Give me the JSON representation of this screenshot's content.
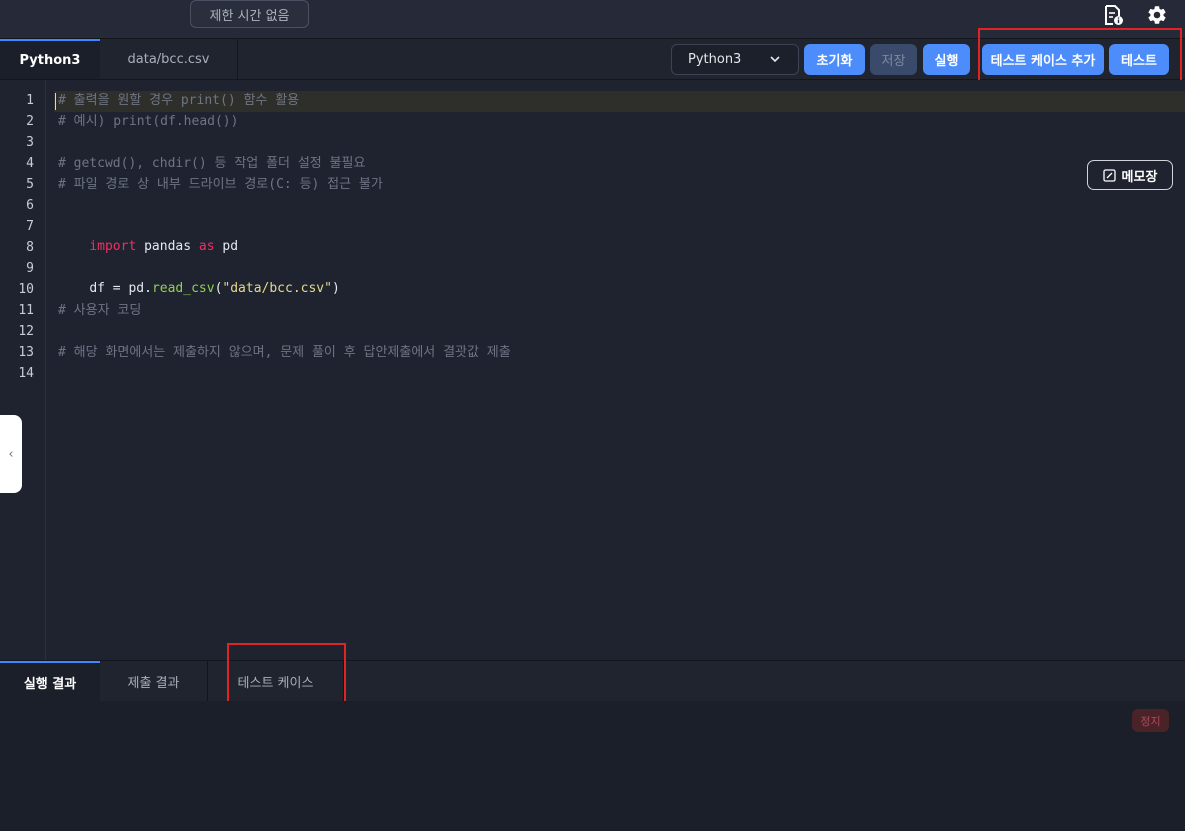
{
  "header": {
    "timer_label": "제한 시간 없음",
    "icons": [
      "file-info-icon",
      "gear-icon"
    ]
  },
  "tabs": [
    {
      "label": "Python3",
      "active": true
    },
    {
      "label": "data/bcc.csv",
      "active": false
    }
  ],
  "toolbar": {
    "language_selected": "Python3",
    "reset_label": "초기화",
    "save_label": "저장",
    "run_label": "실행",
    "add_testcase_label": "테스트 케이스 추가",
    "test_label": "테스트"
  },
  "editor": {
    "line_numbers": [
      "1",
      "2",
      "3",
      "4",
      "5",
      "6",
      "7",
      "8",
      "9",
      "10",
      "11",
      "12",
      "13",
      "14"
    ],
    "lines": {
      "l1": "# 출력을 원할 경우 print() 함수 활용",
      "l2": "# 예시) print(df.head())",
      "l4": "# getcwd(), chdir() 등 작업 폴더 설정 불필요",
      "l5": "# 파일 경로 상 내부 드라이브 경로(C: 등) 접근 불가",
      "l7_kw1": "import",
      "l7_mod": "pandas",
      "l7_kw2": "as",
      "l7_alias": "pd",
      "l9_var": "df = pd.",
      "l9_fn": "read_csv",
      "l9_open": "(",
      "l9_str": "\"data/bcc.csv\"",
      "l9_close": ")",
      "l11": "# 사용자 코딩",
      "l13": "# 해당 화면에서는 제출하지 않으며, 문제 풀이 후 답안제출에서 결괏값 제출"
    },
    "memo_label": "메모장"
  },
  "bottom_tabs": [
    {
      "label": "실행 결과",
      "active": true
    },
    {
      "label": "제출 결과",
      "active": false
    },
    {
      "label": "테스트 케이스",
      "active": false
    }
  ],
  "output": {
    "stop_label": "정지"
  },
  "colors": {
    "accent": "#4c8dfb",
    "highlight_box": "#e02424",
    "keyword": "#f02f61",
    "function": "#8fd14f",
    "string": "#e6d98a"
  }
}
